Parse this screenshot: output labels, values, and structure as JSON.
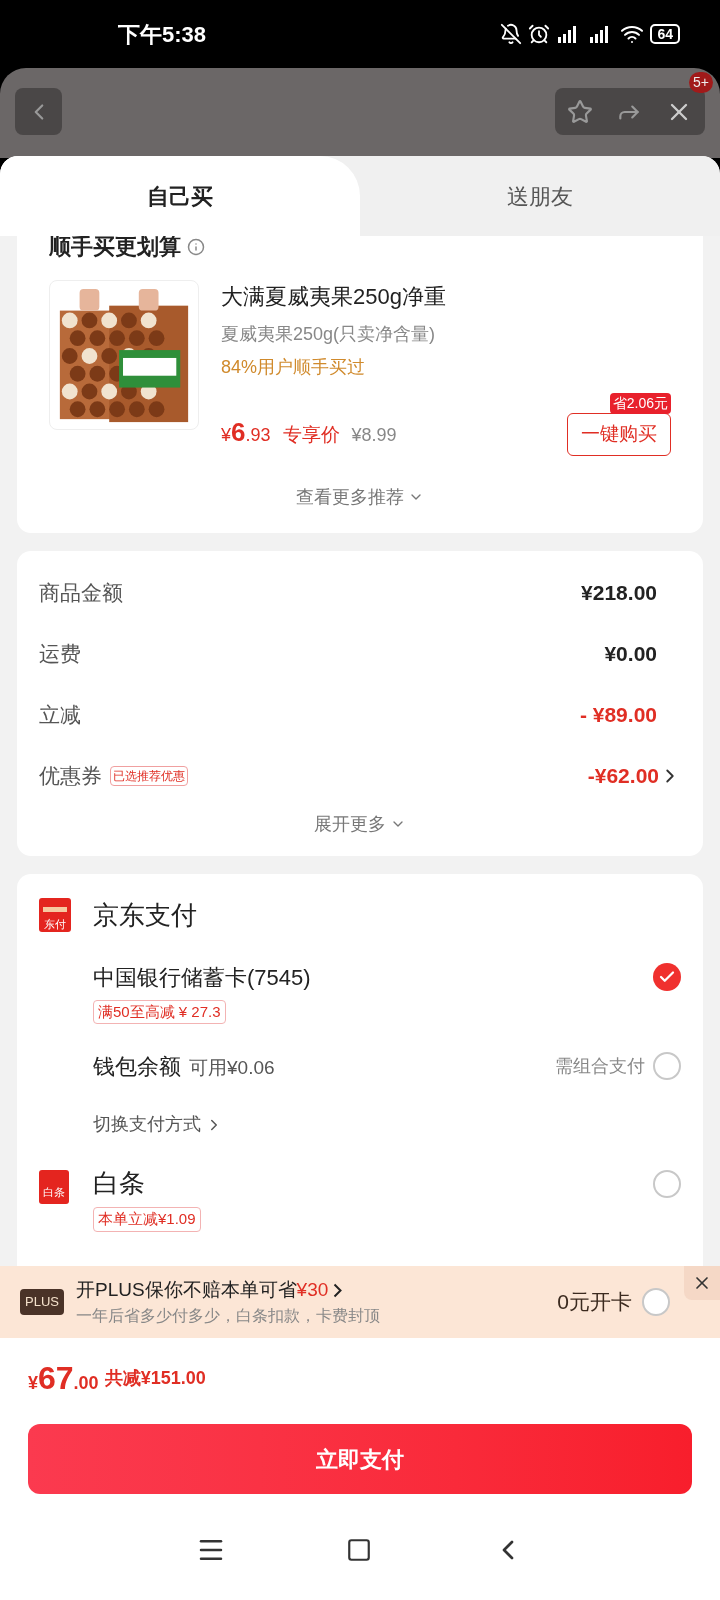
{
  "status_bar": {
    "time": "下午5:38",
    "battery": "64"
  },
  "header": {
    "badge": "5+"
  },
  "tabs": [
    {
      "label": "自己买",
      "selected": true
    },
    {
      "label": "送朋友",
      "selected": false
    }
  ],
  "recommend": {
    "title": "顺手买更划算",
    "product": {
      "name": "大满夏威夷果250g净重",
      "spec": "夏威夷果250g(只卖净含量)",
      "social_proof": "84%用户顺手买过",
      "price_symbol": "¥",
      "price_int": "6",
      "price_dec": ".93",
      "price_label": "专享价",
      "original_price": "¥8.99",
      "save_tag": "省2.06元",
      "buy_button": "一键购买"
    },
    "more": "查看更多推荐"
  },
  "summary": {
    "rows": [
      {
        "label": "商品金额",
        "value": "¥218.00",
        "kind": "normal",
        "arrow": false
      },
      {
        "label": "运费",
        "value": "¥0.00",
        "kind": "normal",
        "arrow": false
      },
      {
        "label": "立减",
        "value": "- ¥89.00",
        "kind": "discount",
        "arrow": false
      },
      {
        "label": "优惠券",
        "tag": "已选推荐优惠",
        "value": "-¥62.00",
        "kind": "discount",
        "arrow": true
      }
    ],
    "expand": "展开更多"
  },
  "payment": {
    "groups": [
      {
        "kind": "jdpay",
        "icon_text": "东付",
        "title": "京东支付",
        "options": [
          {
            "name": "中国银行储蓄卡(7545)",
            "tag": "满50至高减 ¥ 27.3",
            "selected": true
          },
          {
            "name": "钱包余额",
            "note": "可用¥0.06",
            "hint": "需组合支付",
            "selected": false
          }
        ],
        "switch_link": "切换支付方式"
      },
      {
        "kind": "baitiao",
        "icon_text": "白条",
        "title": "白条",
        "tag": "本单立减¥1.09",
        "selected": false
      }
    ]
  },
  "plus": {
    "badge": "PLUS",
    "title": "开PLUS保你不赔本单可省",
    "highlight": "¥30",
    "subtitle": "一年后省多少付多少，白条扣款，卡费封顶",
    "action": "0元开卡",
    "checked": false
  },
  "total": {
    "symbol": "¥",
    "int": "67",
    "dec": ".00",
    "saving": "共减¥151.00"
  },
  "pay_button": "立即支付"
}
